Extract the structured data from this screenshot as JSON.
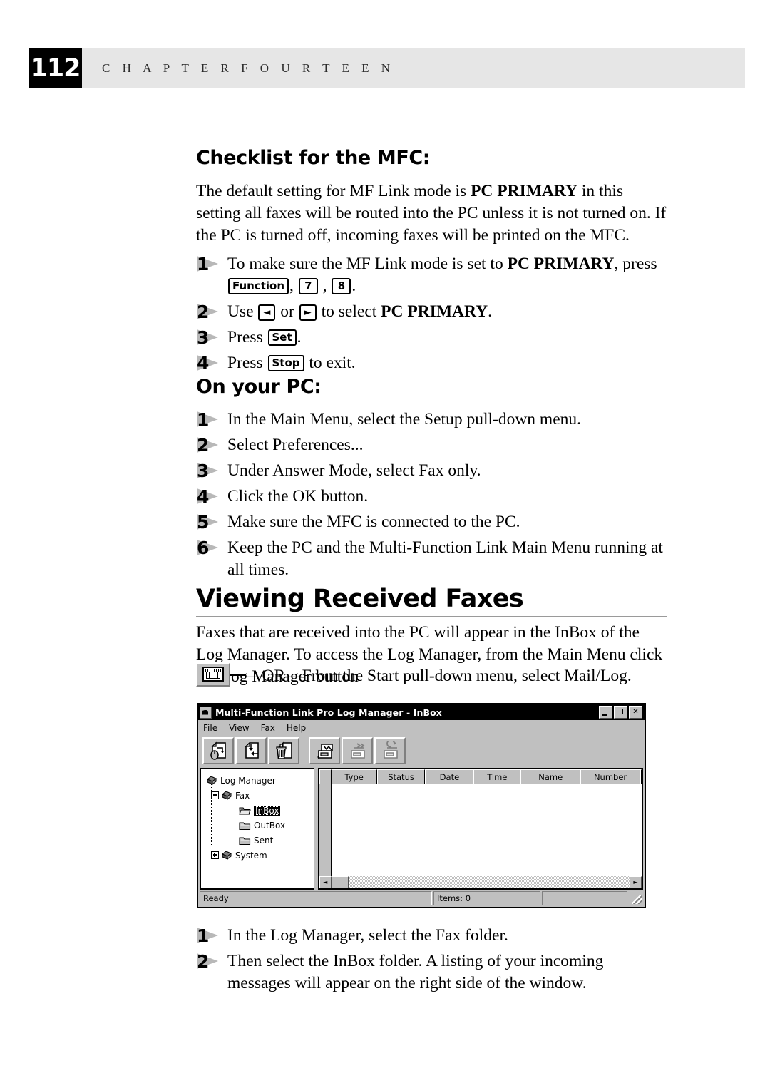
{
  "running_head": {
    "page_number": "112",
    "chapter_label": "C H A P T E R   F O U R T E E N"
  },
  "sections": {
    "checklist": {
      "heading": "Checklist for the MFC:",
      "intro_a": "The default setting for MF Link mode is ",
      "intro_bold": "PC PRIMARY",
      "intro_b": " in this setting all faxes will be routed into the PC unless it is not turned on. If the PC is turned off, incoming faxes will be printed on the MFC.",
      "steps": [
        {
          "number": "1",
          "text_a": "To make sure the MF Link mode is set to ",
          "bold": "PC PRIMARY",
          "text_b": ", press ",
          "key1": "Function",
          "sep1": ", ",
          "key2": "7",
          "sep2": " , ",
          "key3": "8",
          "text_c": "."
        },
        {
          "number": "2",
          "text_a": "Use ",
          "key1": "◄",
          "text_b": " or ",
          "key2": "►",
          "text_c": " to select ",
          "bold": "PC PRIMARY",
          "text_d": "."
        },
        {
          "number": "3",
          "text_a": "Press ",
          "key1": "Set",
          "text_b": "."
        },
        {
          "number": "4",
          "text_a": "Press ",
          "key1": "Stop",
          "text_b": " to exit."
        }
      ]
    },
    "on_your_pc": {
      "heading": "On your PC:",
      "steps": [
        {
          "number": "1",
          "text": "In the Main Menu, select the Setup pull-down menu."
        },
        {
          "number": "2",
          "text": "Select Preferences..."
        },
        {
          "number": "3",
          "text": "Under Answer Mode, select Fax only."
        },
        {
          "number": "4",
          "text": "Click the OK button."
        },
        {
          "number": "5",
          "text": "Make sure the MFC is connected to the PC."
        },
        {
          "number": "6",
          "text": "Keep the PC and the Multi-Function Link Main Menu running at all times."
        }
      ]
    },
    "viewing_faxes": {
      "heading": "Viewing Received Faxes",
      "paragraph": "Faxes that are received into the PC will appear in the InBox of the Log Manager. To access the Log Manager, from the Main Menu click the Log Manager button",
      "or_line": "—OR—From the Start pull-down menu, select  Mail/Log.",
      "button_icon_name": "log-manager-button-icon",
      "steps": [
        {
          "number": "1",
          "text": "In the Log Manager, select the Fax folder."
        },
        {
          "number": "2",
          "text": "Then select the InBox folder.  A listing of your incoming messages will appear on the right side of the window."
        }
      ]
    }
  },
  "screenshot_window": {
    "title": "Multi-Function Link Pro Log Manager - InBox",
    "title_buttons": [
      {
        "name": "minimize",
        "label": ""
      },
      {
        "name": "maximize",
        "label": ""
      },
      {
        "name": "close",
        "label": "✕"
      }
    ],
    "menus": [
      {
        "accel": "F",
        "rest": "ile"
      },
      {
        "accel": "V",
        "rest": "iew"
      },
      {
        "pre": "Fa",
        "accel": "x",
        "rest": ""
      },
      {
        "accel": "H",
        "rest": "elp"
      }
    ],
    "toolbar": {
      "group1": [
        {
          "name": "view-document-button",
          "enabled": true
        },
        {
          "name": "move-document-button",
          "enabled": true
        },
        {
          "name": "delete-document-button",
          "enabled": true
        }
      ],
      "group2": [
        {
          "name": "send-fax-button",
          "enabled": true
        },
        {
          "name": "forward-fax-button",
          "enabled": false
        },
        {
          "name": "resend-fax-button",
          "enabled": false
        }
      ]
    },
    "tree": [
      {
        "label": "Log Manager",
        "icon": "network-node-icon",
        "level": 0,
        "expander": "none",
        "selected": false
      },
      {
        "label": "Fax",
        "icon": "network-node-icon",
        "level": 1,
        "expander": "minus",
        "selected": false
      },
      {
        "label": "InBox",
        "icon": "open-folder-icon",
        "level": 2,
        "expander": "none",
        "selected": true
      },
      {
        "label": "OutBox",
        "icon": "folder-icon",
        "level": 2,
        "expander": "none",
        "selected": false
      },
      {
        "label": "Sent",
        "icon": "folder-icon",
        "level": 2,
        "expander": "none",
        "selected": false
      },
      {
        "label": "System",
        "icon": "network-node-icon",
        "level": 1,
        "expander": "plus",
        "selected": false
      }
    ],
    "columns": [
      "Type",
      "Status",
      "Date",
      "Time",
      "Name",
      "Number"
    ],
    "rows": [],
    "status_bar": {
      "ready": "Ready",
      "items": "Items: 0",
      "blank": ""
    },
    "scroll": {
      "left_arrow": "◄",
      "right_arrow": "►"
    }
  }
}
